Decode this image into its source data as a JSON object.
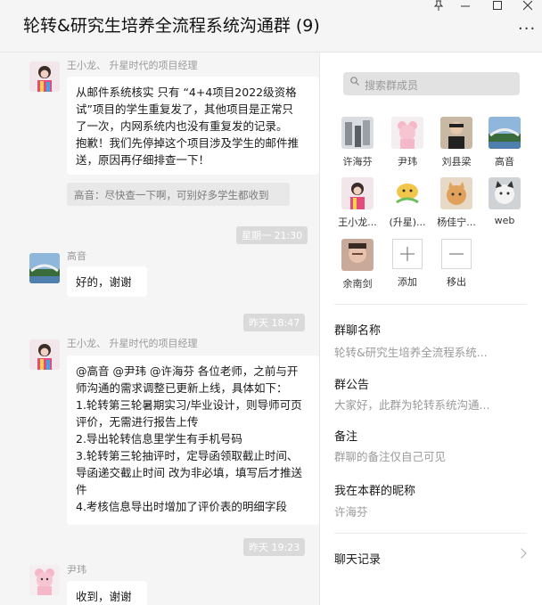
{
  "window": {
    "title": "轮转&研究生培养全流程系统沟通群 (9)",
    "pin_icon": "pin-icon",
    "more_label": "···"
  },
  "chat": {
    "messages": [
      {
        "sender": "王小龙、 升星时代的项目经理",
        "lines": [
          "从邮件系统核实 只有 “4+4项目2022级资格",
          "试”项目的学生重复发了，其他项目是正常只",
          "了一次，内网系统内也没有重复发的记录。",
          "抱歉！我们先停掉这个项目涉及学生的邮件推",
          "送，原因再仔细排查一下！"
        ],
        "quote": "高音：尽快查一下啊，可别好多学生都收到"
      },
      {
        "time": "星期一 21:30"
      },
      {
        "sender": "高音",
        "lines": [
          "好的，谢谢"
        ]
      },
      {
        "time": "昨天 18:47"
      },
      {
        "sender": "王小龙、 升星时代的项目经理",
        "lines": [
          "@高音 @尹玮 @许海芬 各位老师，之前与开",
          "师沟通的需求调整已更新上线，具体如下：",
          "1.轮转第三轮暑期实习/毕业设计，则导师可页",
          "评价，无需进行报告上传",
          "2.导出轮转信息里学生有手机号码",
          "3.轮转第三轮抽评时，定导函领取截止时间、",
          "导函递交截止时间 改为非必填，填写后才推送",
          "件",
          "4.考核信息导出时增加了评价表的明细字段"
        ]
      },
      {
        "time": "昨天 19:23"
      },
      {
        "sender": "尹玮",
        "lines": [
          "收到，谢谢"
        ]
      }
    ]
  },
  "panel": {
    "search_placeholder": "搜索群成员",
    "members": [
      {
        "name": "许海芬"
      },
      {
        "name": "尹玮"
      },
      {
        "name": "刘县梁"
      },
      {
        "name": "高音"
      },
      {
        "name": "王小龙..."
      },
      {
        "name": "(升星)..."
      },
      {
        "name": "杨佳宁..."
      },
      {
        "name": "web"
      },
      {
        "name": "余南剑"
      },
      {
        "name": "添加"
      },
      {
        "name": "移出"
      }
    ],
    "group_name_label": "群聊名称",
    "group_name_value": "轮转&研究生培养全流程系统...",
    "notice_label": "群公告",
    "notice_value": "大家好，此群为轮转系统沟通...",
    "remark_label": "备注",
    "remark_value": "群聊的备注仅自己可见",
    "nickname_label": "我在本群的昵称",
    "nickname_value": "许海芬",
    "history_label": "聊天记录"
  }
}
